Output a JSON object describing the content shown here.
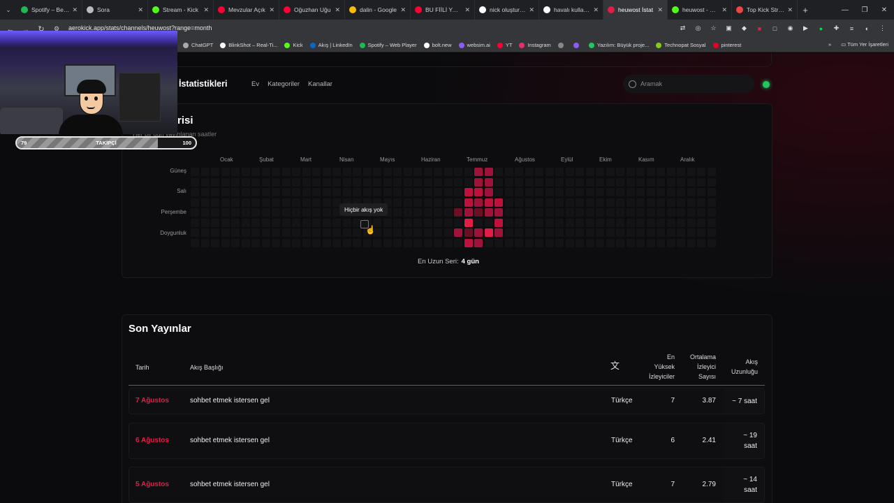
{
  "browser": {
    "tabs": [
      {
        "title": "Spotify – Beğen",
        "color": "#1db954"
      },
      {
        "title": "Sora",
        "color": "#bbbbbb"
      },
      {
        "title": "Stream - Kick",
        "color": "#53fc18"
      },
      {
        "title": "Mevzular Açık",
        "color": "#ff0033"
      },
      {
        "title": "Oğuzhan Uğu",
        "color": "#ff0033"
      },
      {
        "title": "dalin - Google",
        "color": "#fbbc05"
      },
      {
        "title": "BU FİİLİ YAPM",
        "color": "#ff0033"
      },
      {
        "title": "nick oluşturucu",
        "color": "#ffffff"
      },
      {
        "title": "havalı kullanıcı",
        "color": "#ffffff"
      },
      {
        "title": "heuwost İstat",
        "color": "#e11d48",
        "active": true
      },
      {
        "title": "heuwost - Kick",
        "color": "#53fc18"
      },
      {
        "title": "Top Kick Strea",
        "color": "#ef4444"
      }
    ],
    "close_glyph": "✕",
    "new_tab": "+",
    "url": "aerokick.app/stats/channels/heuwost?range=month",
    "bookmarks": [
      {
        "label": "ChatGPT",
        "color": "#aaaaaa"
      },
      {
        "label": "BlinkShot – Real-Ti...",
        "color": "#ffffff"
      },
      {
        "label": "Kick",
        "color": "#53fc18"
      },
      {
        "label": "Akış | LinkedIn",
        "color": "#0a66c2"
      },
      {
        "label": "Spotify – Web Player",
        "color": "#1db954"
      },
      {
        "label": "bolt.new",
        "color": "#ffffff"
      },
      {
        "label": "websim.ai",
        "color": "#8b5cf6"
      },
      {
        "label": "YT",
        "color": "#ff0033"
      },
      {
        "label": "Instagram",
        "color": "#e1306c"
      },
      {
        "label": "",
        "color": "#888888"
      },
      {
        "label": "",
        "color": "#8b5cf6"
      },
      {
        "label": "Yazılım: Büyük proje...",
        "color": "#22c55e"
      },
      {
        "label": "Technopat Sosyal",
        "color": "#84cc16"
      },
      {
        "label": "pinterest",
        "color": "#e60023"
      }
    ],
    "bookmarks_more": "»",
    "all_bookmarks": "Tüm Yer İşaretleri"
  },
  "site": {
    "title": "İstatistikleri",
    "nav": [
      "Ev",
      "Kategoriler",
      "Kanallar"
    ],
    "search_placeholder": "Aramak"
  },
  "heatmap": {
    "title": "risi",
    "subtitle": "Her bir gün yayınlanan saatler",
    "months": [
      "Ocak",
      "Şubat",
      "Mart",
      "Nisan",
      "Mayıs",
      "Haziran",
      "Temmuz",
      "Ağustos",
      "Eylül",
      "Ekim",
      "Kasım",
      "Aralık"
    ],
    "days": [
      "Güneş",
      "Salı",
      "Perşembe",
      "Doygunluk"
    ],
    "tooltip": "Hiçbir akış yok",
    "streak_label": "En Uzun Seri:",
    "streak_value": "4 gün",
    "active_cells": [
      {
        "week": 28,
        "day": 0,
        "level": 2
      },
      {
        "week": 29,
        "day": 0,
        "level": 2
      },
      {
        "week": 28,
        "day": 1,
        "level": 2
      },
      {
        "week": 29,
        "day": 1,
        "level": 2
      },
      {
        "week": 27,
        "day": 2,
        "level": 3
      },
      {
        "week": 28,
        "day": 2,
        "level": 3
      },
      {
        "week": 29,
        "day": 2,
        "level": 2
      },
      {
        "week": 27,
        "day": 3,
        "level": 3
      },
      {
        "week": 28,
        "day": 3,
        "level": 2
      },
      {
        "week": 29,
        "day": 3,
        "level": 3
      },
      {
        "week": 30,
        "day": 3,
        "level": 3
      },
      {
        "week": 26,
        "day": 4,
        "level": 1
      },
      {
        "week": 27,
        "day": 4,
        "level": 2
      },
      {
        "week": 28,
        "day": 4,
        "level": 1
      },
      {
        "week": 29,
        "day": 4,
        "level": 2
      },
      {
        "week": 30,
        "day": 4,
        "level": 2
      },
      {
        "week": 27,
        "day": 5,
        "level": 4
      },
      {
        "week": 30,
        "day": 5,
        "level": 3
      },
      {
        "week": 26,
        "day": 6,
        "level": 2
      },
      {
        "week": 27,
        "day": 6,
        "level": 1
      },
      {
        "week": 28,
        "day": 6,
        "level": 2
      },
      {
        "week": 29,
        "day": 6,
        "level": 4
      },
      {
        "week": 30,
        "day": 6,
        "level": 2
      },
      {
        "week": 27,
        "day": 7,
        "level": 3
      },
      {
        "week": 28,
        "day": 7,
        "level": 2
      }
    ],
    "level_colors": [
      "#141416",
      "#6b0f24",
      "#9f1239",
      "#be123c",
      "#e11d48"
    ]
  },
  "recent": {
    "title": "Son Yayınlar",
    "headers": {
      "date": "Tarih",
      "stream_title": "Akış Başlığı",
      "peak": [
        "En",
        "Yüksek",
        "İzleyiciler"
      ],
      "avg": [
        "Ortalama",
        "İzleyici",
        "Sayısı"
      ],
      "duration": [
        "Akış",
        "Uzunluğu"
      ]
    },
    "rows": [
      {
        "date": "7 Ağustos",
        "title": "sohbet etmek istersen gel",
        "lang": "Türkçe",
        "peak": "7",
        "avg": "3.87",
        "duration": [
          "~ 7 saat"
        ]
      },
      {
        "date": "6 Ağustos",
        "title": "sohbet etmek istersen gel",
        "lang": "Türkçe",
        "peak": "6",
        "avg": "2.41",
        "duration": [
          "~ 19",
          "saat"
        ]
      },
      {
        "date": "5 Ağustos",
        "title": "sohbet etmek istersen gel",
        "lang": "Türkçe",
        "peak": "7",
        "avg": "2.79",
        "duration": [
          "~ 14",
          "saat"
        ]
      }
    ]
  },
  "overlay": {
    "follower_label": "TAKİPÇİ",
    "follower_current": "79",
    "follower_goal": "100",
    "progress_fraction": 0.79
  }
}
